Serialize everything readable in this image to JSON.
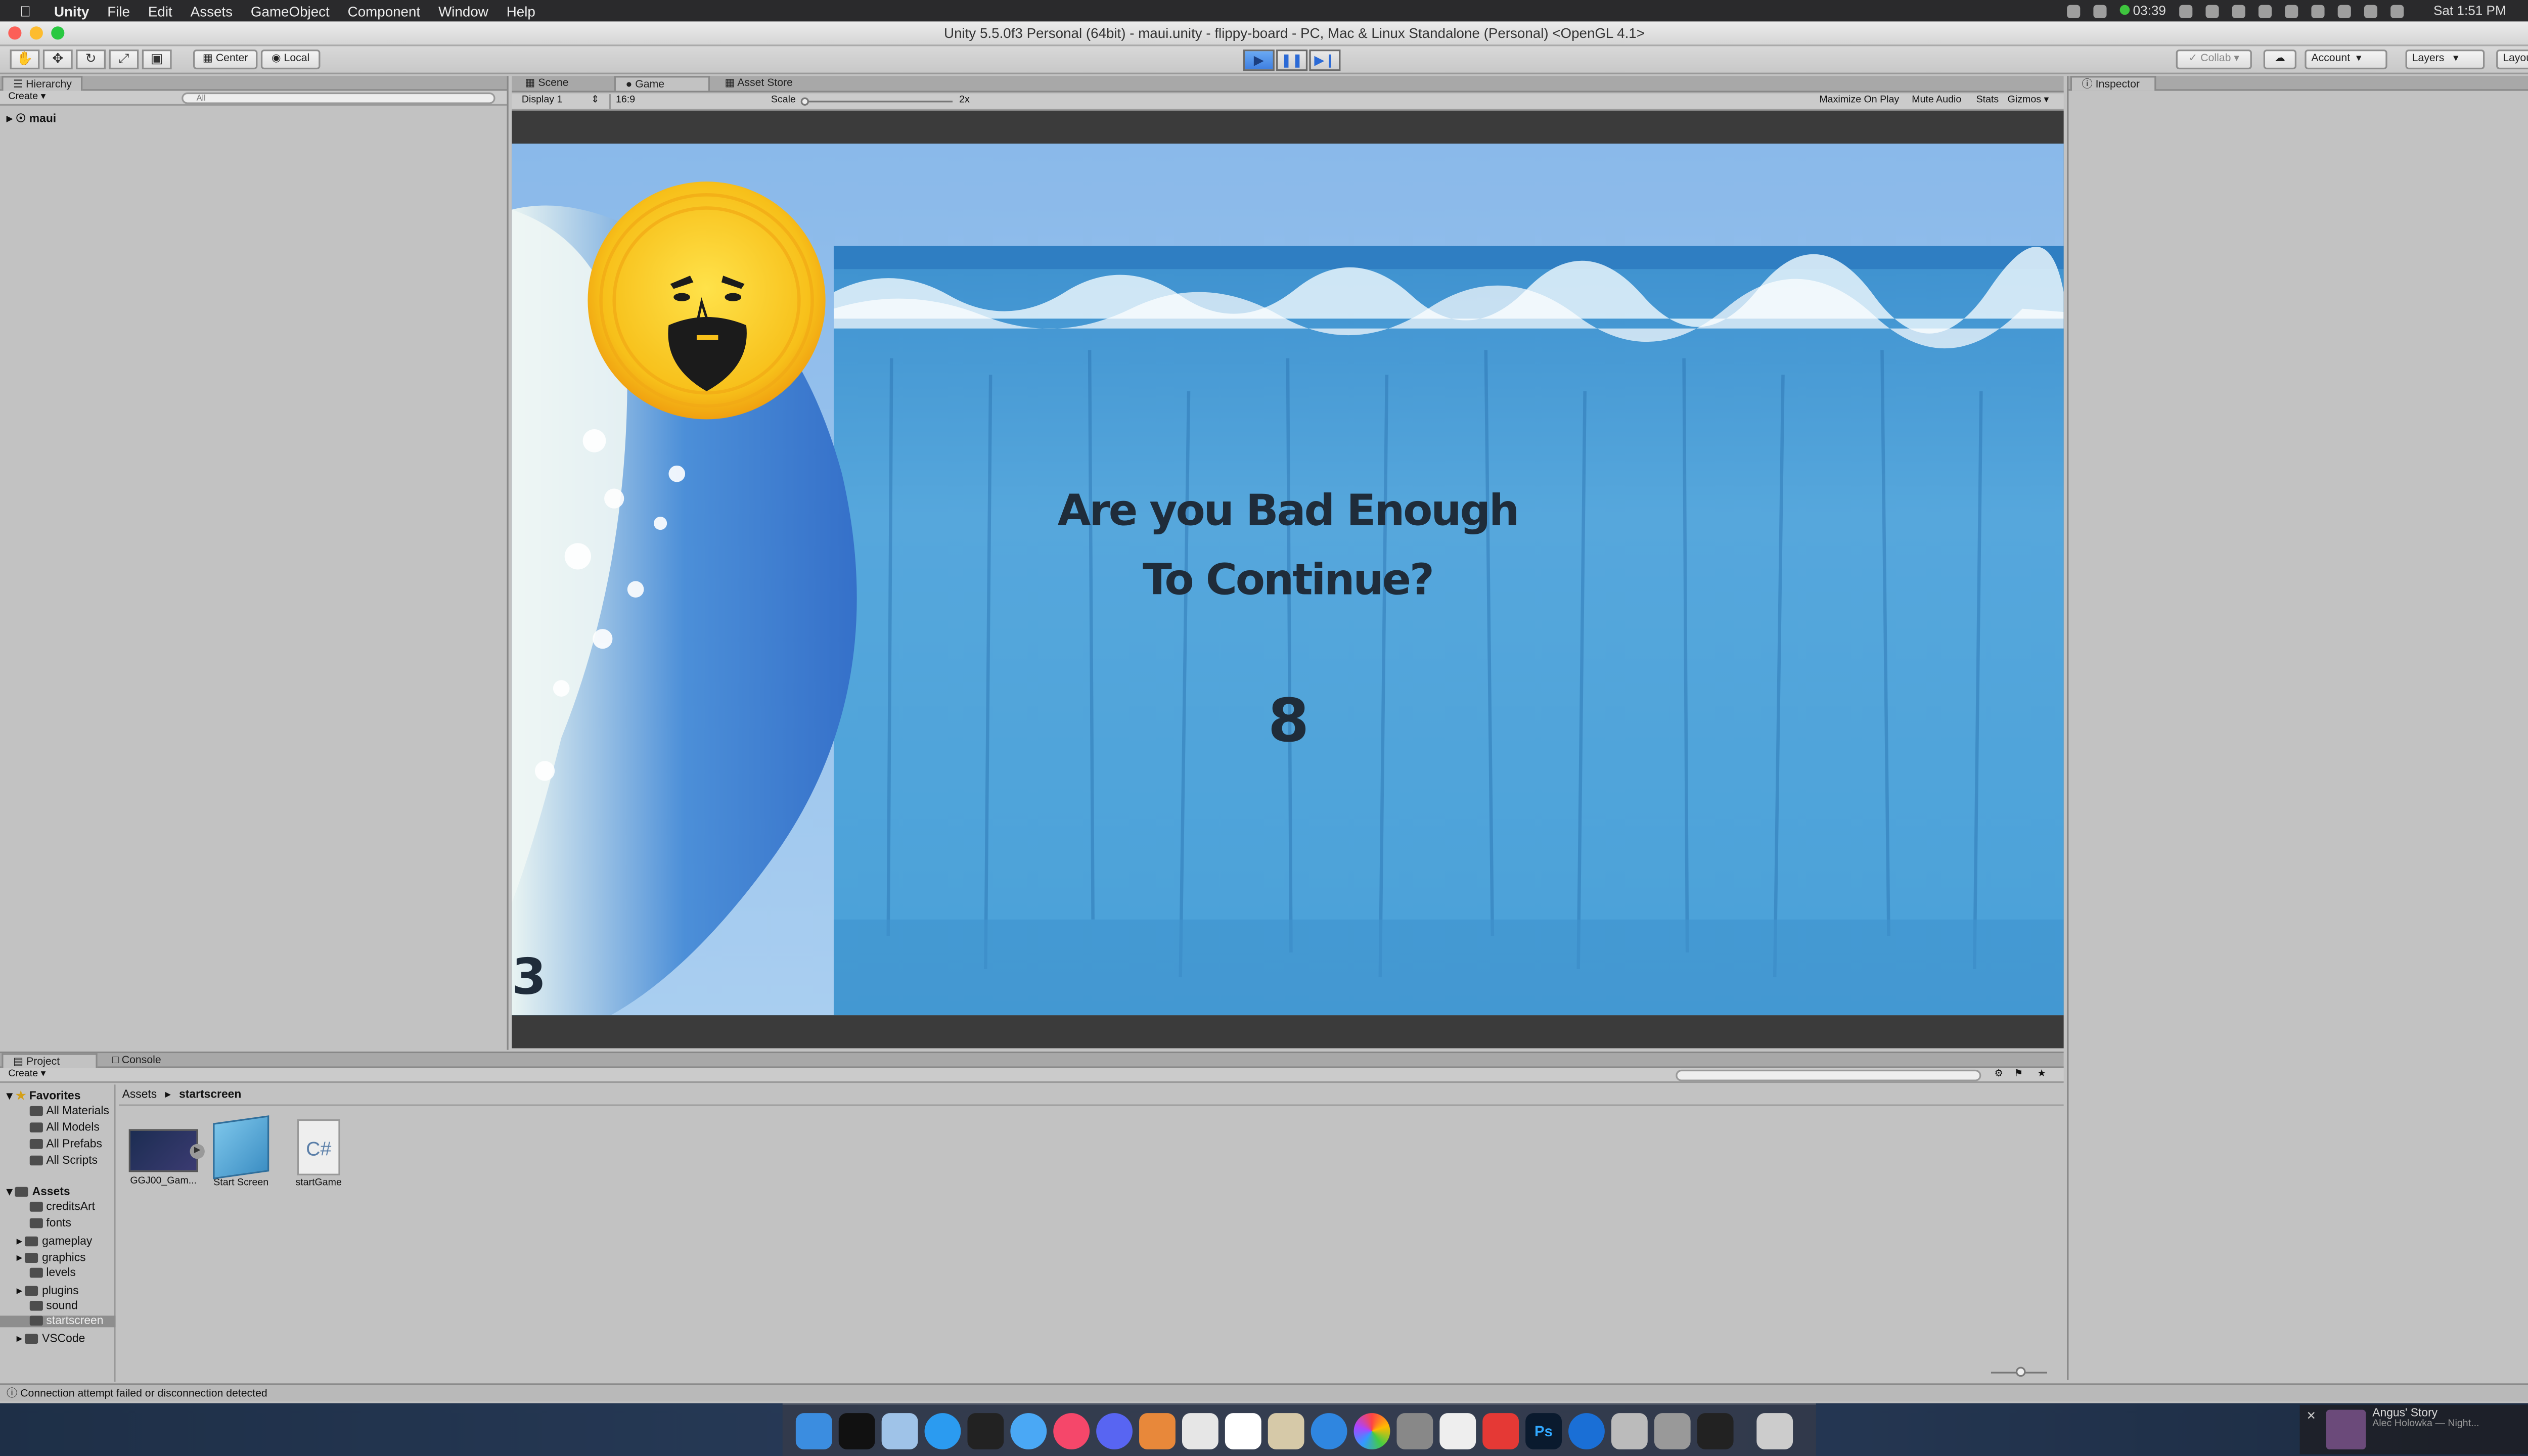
{
  "menubar": {
    "app_name": "Unity",
    "items": [
      "File",
      "Edit",
      "Assets",
      "GameObject",
      "Component",
      "Window",
      "Help"
    ],
    "timer": "03:39",
    "clock": "Sat 1:51 PM"
  },
  "window": {
    "title": "Unity 5.5.0f3 Personal (64bit) - maui.unity - flippy-board - PC, Mac & Linux Standalone (Personal) <OpenGL 4.1>"
  },
  "toolbar": {
    "pivot_label": "Center",
    "space_label": "Local",
    "collab_label": "Collab",
    "account_label": "Account",
    "layers_label": "Layers",
    "layout_label": "Layout"
  },
  "hierarchy": {
    "tab": "Hierarchy",
    "create_label": "Create",
    "search_placeholder": "All",
    "root_item": "maui"
  },
  "center_tabs": {
    "scene": "Scene",
    "game": "Game",
    "asset_store": "Asset Store"
  },
  "game_view": {
    "display": "Display 1",
    "aspect": "16:9",
    "scale_label": "Scale",
    "scale_value": "2x",
    "maximize": "Maximize On Play",
    "mute": "Mute Audio",
    "stats": "Stats",
    "gizmos": "Gizmos",
    "prompt_line1": "Are you Bad Enough",
    "prompt_line2": "To Continue?",
    "countdown": "8",
    "score": "3"
  },
  "inspector": {
    "tab": "Inspector"
  },
  "project": {
    "tab_project": "Project",
    "tab_console": "Console",
    "create_label": "Create",
    "breadcrumb_root": "Assets",
    "breadcrumb_current": "startscreen",
    "favorites_label": "Favorites",
    "favorites": [
      "All Materials",
      "All Models",
      "All Prefabs",
      "All Scripts"
    ],
    "assets_label": "Assets",
    "folders": [
      "creditsArt",
      "fonts",
      "gameplay",
      "graphics",
      "levels",
      "plugins",
      "sound",
      "startscreen",
      "VSCode"
    ],
    "selected_folder": "startscreen",
    "files": [
      "GGJ00_Gam...",
      "Start Screen",
      "startGame"
    ]
  },
  "status": {
    "message": "Connection attempt failed or disconnection detected"
  },
  "notification": {
    "title": "Angus' Story",
    "subtitle": "Alec Holowka — Night..."
  },
  "colors": {
    "play_active": "#3f7fe0",
    "sky": "#8fbfea",
    "water": "#58a9dc",
    "sun": "#f7c51c",
    "menubar": "#2a2a2c"
  }
}
